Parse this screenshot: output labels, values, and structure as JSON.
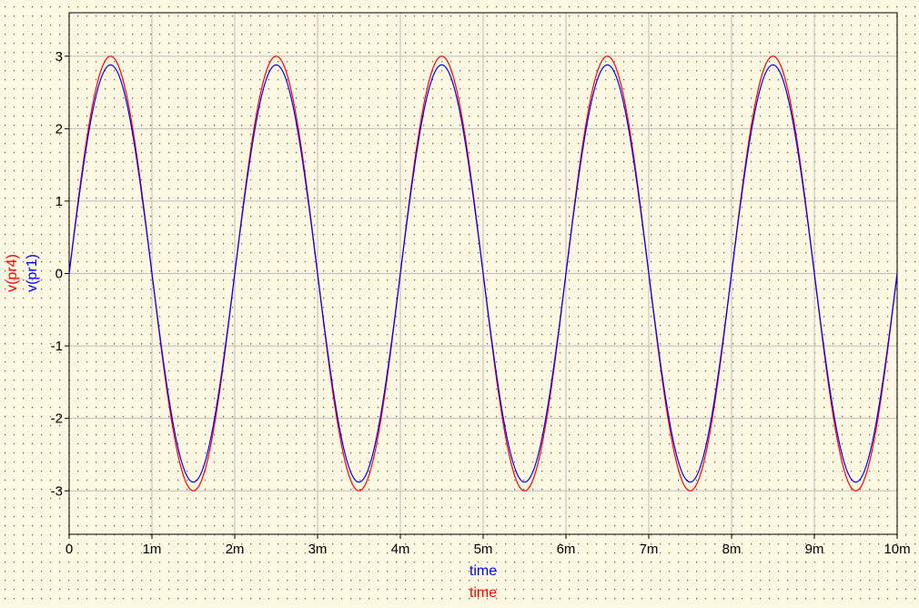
{
  "chart_data": {
    "type": "line",
    "x_tick_labels": [
      "0",
      "1m",
      "2m",
      "3m",
      "4m",
      "5m",
      "6m",
      "7m",
      "8m",
      "9m",
      "10m"
    ],
    "y_tick_labels": [
      "-3",
      "-2",
      "-1",
      "0",
      "1",
      "2",
      "3"
    ],
    "xlim": [
      0,
      0.01
    ],
    "ylim": [
      -3.6,
      3.6
    ],
    "grid": true,
    "x_labels": [
      {
        "text": "time",
        "color": "#0000ff"
      },
      {
        "text": "time",
        "color": "#ff0000"
      }
    ],
    "y_labels": [
      {
        "text": "v(pr4)",
        "color": "#ff0000"
      },
      {
        "text": "v(pr1)",
        "color": "#0000ff"
      }
    ],
    "series": [
      {
        "name": "v(pr4)",
        "color": "#ff0000",
        "function": "sine",
        "amplitude": 3.0,
        "frequency_hz": 500,
        "offset": 0,
        "x_range": [
          0,
          0.01
        ],
        "peaks": [
          [
            0.0005,
            3.0
          ],
          [
            0.0025,
            3.0
          ],
          [
            0.0045,
            3.0
          ],
          [
            0.0065,
            3.0
          ],
          [
            0.0085,
            3.0
          ]
        ],
        "troughs": [
          [
            0.0015,
            -3.0
          ],
          [
            0.0035,
            -3.0
          ],
          [
            0.0055,
            -3.0
          ],
          [
            0.0075,
            -3.0
          ],
          [
            0.0095,
            -3.0
          ]
        ]
      },
      {
        "name": "v(pr1)",
        "color": "#0000ff",
        "function": "sine",
        "amplitude": 2.88,
        "frequency_hz": 500,
        "offset": 0,
        "x_range": [
          0,
          0.01
        ],
        "peaks": [
          [
            0.0005,
            2.9
          ],
          [
            0.0025,
            2.9
          ],
          [
            0.0045,
            2.9
          ],
          [
            0.0065,
            2.9
          ],
          [
            0.0085,
            2.9
          ]
        ],
        "troughs": [
          [
            0.0015,
            -2.86
          ],
          [
            0.0035,
            -2.86
          ],
          [
            0.0055,
            -2.86
          ],
          [
            0.0075,
            -2.86
          ],
          [
            0.0095,
            -2.86
          ]
        ]
      }
    ]
  }
}
